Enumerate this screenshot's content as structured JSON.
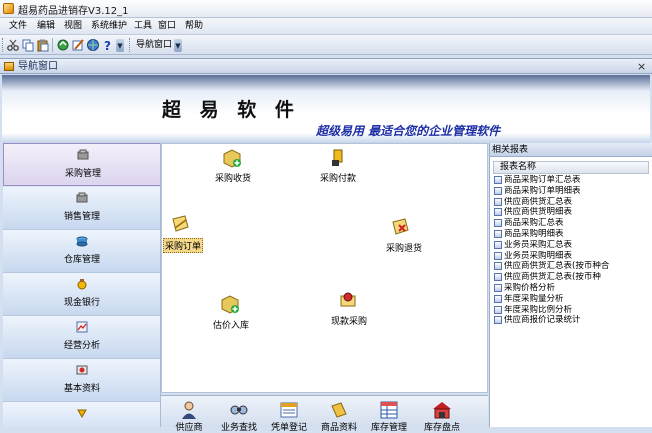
{
  "window": {
    "title": "超易药品进销存V3.12_1"
  },
  "menu": [
    "文件",
    "编辑",
    "视图",
    "系统维护",
    "工具",
    "窗口",
    "帮助"
  ],
  "toolbar": {
    "icons": [
      "cut-icon",
      "copy-icon",
      "paste-icon",
      "refresh-icon",
      "edit-icon",
      "globe-icon",
      "help-icon"
    ],
    "nav_window_label": "导航窗口"
  },
  "nav_window": {
    "title": "导航窗口",
    "close_glyph": "×"
  },
  "banner": {
    "title": "超 易 软 件",
    "slogan": "超级易用 最适合您的企业管理软件"
  },
  "sidebar": {
    "items": [
      {
        "label": "采购管理",
        "icon": "purchase-icon",
        "active": true
      },
      {
        "label": "销售管理",
        "icon": "sales-icon"
      },
      {
        "label": "仓库管理",
        "icon": "warehouse-icon"
      },
      {
        "label": "现金银行",
        "icon": "cash-icon"
      },
      {
        "label": "经营分析",
        "icon": "analysis-icon"
      },
      {
        "label": "基本资料",
        "icon": "basic-data-icon"
      },
      {
        "label": "",
        "icon": "more-icon"
      }
    ]
  },
  "functions": [
    {
      "label": "采购收货",
      "icon": "receive-goods-icon"
    },
    {
      "label": "采购付款",
      "icon": "payment-icon"
    },
    {
      "label": "采购订单",
      "icon": "purchase-order-icon",
      "selected": true
    },
    {
      "label": "采购退货",
      "icon": "purchase-return-icon"
    },
    {
      "label": "估价入库",
      "icon": "valuation-stockin-icon"
    },
    {
      "label": "现款采购",
      "icon": "cash-purchase-icon"
    }
  ],
  "bottom_shortcuts": [
    {
      "label": "供应商",
      "icon": "supplier-icon"
    },
    {
      "label": "业务查找",
      "icon": "search-business-icon"
    },
    {
      "label": "凭单登记",
      "icon": "voucher-icon"
    },
    {
      "label": "商品资料",
      "icon": "goods-data-icon"
    },
    {
      "label": "库存管理",
      "icon": "stock-icon"
    },
    {
      "label": "库存盘点",
      "icon": "inventory-icon"
    }
  ],
  "reports": {
    "panel_title": "相关报表",
    "column_header": "报表名称",
    "items": [
      "商品采购订单汇总表",
      "商品采购订单明细表",
      "供应商供货汇总表",
      "供应商供货明细表",
      "商品采购汇总表",
      "商品采购明细表",
      "业务员采购汇总表",
      "业务员采购明细表",
      "供应商供货汇总表(按币种合",
      "供应商供货汇总表(按币种",
      "采购价格分析",
      "年度采购量分析",
      "年度采购比例分析",
      "供应商报价记录统计"
    ]
  },
  "colors": {
    "accent": "#1e2fa4",
    "selection": "#f5d98a"
  }
}
